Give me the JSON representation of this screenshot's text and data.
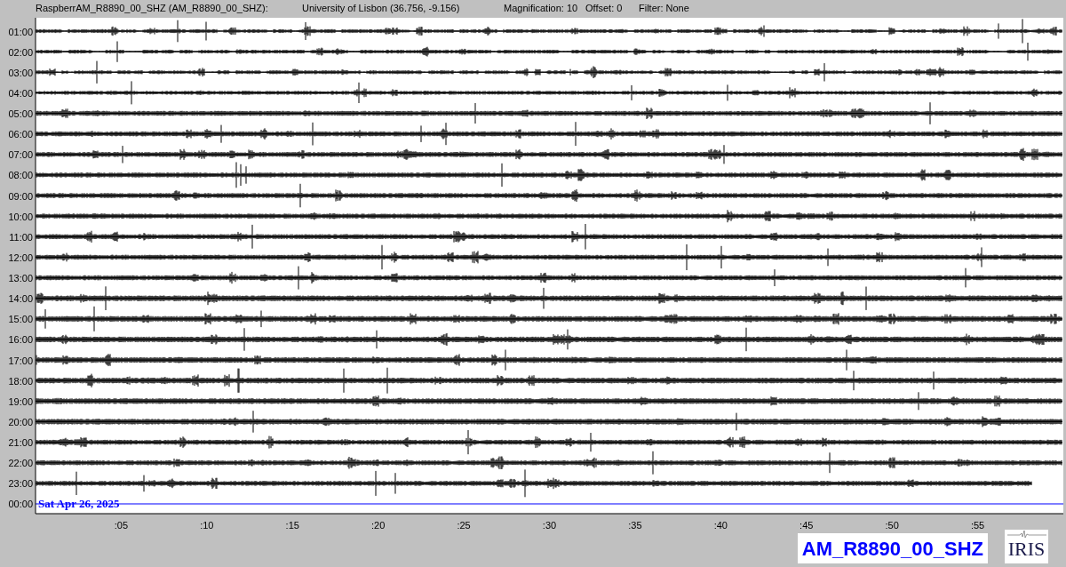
{
  "header": {
    "station": "RaspberrAM_R8890_00_SHZ (AM_R8890_00_SHZ):",
    "location": "University of Lisbon (36.756, -9.156)",
    "magnification": "Magnification: 10",
    "offset": "Offset: 0",
    "filter": "Filter: None"
  },
  "rows": [
    {
      "time": "01:00",
      "kind": "trace"
    },
    {
      "time": "02:00",
      "kind": "trace"
    },
    {
      "time": "03:00",
      "kind": "trace"
    },
    {
      "time": "04:00",
      "kind": "trace"
    },
    {
      "time": "05:00",
      "kind": "trace"
    },
    {
      "time": "06:00",
      "kind": "trace"
    },
    {
      "time": "07:00",
      "kind": "trace"
    },
    {
      "time": "08:00",
      "kind": "trace"
    },
    {
      "time": "09:00",
      "kind": "trace"
    },
    {
      "time": "10:00",
      "kind": "trace"
    },
    {
      "time": "11:00",
      "kind": "trace"
    },
    {
      "time": "12:00",
      "kind": "trace"
    },
    {
      "time": "13:00",
      "kind": "trace"
    },
    {
      "time": "14:00",
      "kind": "trace"
    },
    {
      "time": "15:00",
      "kind": "trace"
    },
    {
      "time": "16:00",
      "kind": "trace"
    },
    {
      "time": "17:00",
      "kind": "trace"
    },
    {
      "time": "18:00",
      "kind": "trace"
    },
    {
      "time": "19:00",
      "kind": "trace"
    },
    {
      "time": "20:00",
      "kind": "trace"
    },
    {
      "time": "21:00",
      "kind": "trace"
    },
    {
      "time": "22:00",
      "kind": "trace"
    },
    {
      "time": "23:00",
      "kind": "partial"
    },
    {
      "time": "00:00",
      "kind": "current"
    }
  ],
  "date_label": "Sat Apr 26, 2025",
  "x_ticks": [
    ":05",
    ":10",
    ":15",
    ":20",
    ":25",
    ":30",
    ":35",
    ":40",
    ":45",
    ":50",
    ":55"
  ],
  "station_label": "AM_R8890_00_SHZ",
  "logo_text": "IRIS"
}
